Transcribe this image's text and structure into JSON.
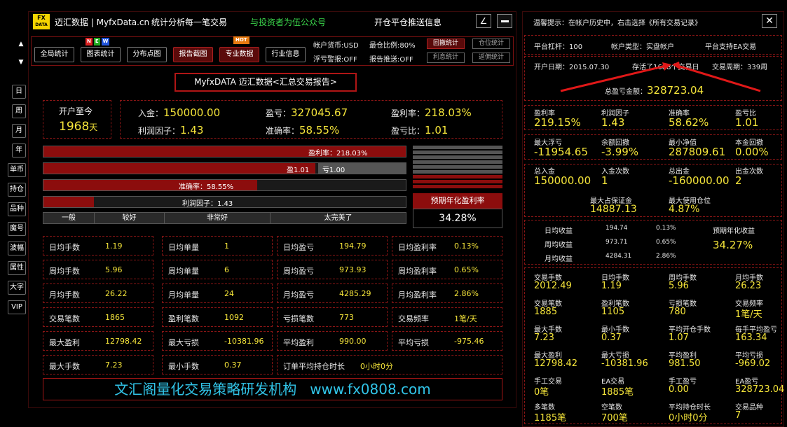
{
  "header": {
    "logo_top": "FX",
    "logo_bottom": "DATA",
    "title": "迈汇数据 | MyfxData.cn",
    "subtitle": "统计分析每一笔交易",
    "promo": "与投资者为伍公众号",
    "push": "开仓平仓推送信息"
  },
  "side": [
    "日",
    "周",
    "月",
    "年",
    "单币",
    "持仓",
    "品种",
    "魔号",
    "波幅",
    "属性",
    "大字",
    "VIP"
  ],
  "toolbar": {
    "tabs": [
      "全局统计",
      "图表统计",
      "分布点图",
      "报告截图",
      "专业数据",
      "行业信息"
    ],
    "new_badge": "NEW",
    "hot_badge": "HOT"
  },
  "account": {
    "currency": "帐户货币:USD",
    "max_ratio": "最仓比例:80%",
    "float_warn": "浮亏警报:OFF",
    "report_push": "报告推送:OFF",
    "btn1": "回撤统计",
    "btn2": "仓位统计",
    "btn3": "利息统计",
    "btn4": "返佣统计"
  },
  "report_title": "MyfxDATA 迈汇数据<汇总交易报告>",
  "summary": {
    "days_label": "开户至今",
    "days": "1968",
    "days_unit": "天",
    "deposit_k": "入金：",
    "deposit_v": "150000.00",
    "profit_k": "盈亏：",
    "profit_v": "327045.67",
    "rate_k": "盈利率：",
    "rate_v": "218.03%",
    "pf_k": "利润因子：",
    "pf_v": "1.43",
    "acc_k": "准确率：",
    "acc_v": "58.55%",
    "pl_k": "盈亏比：",
    "pl_v": "1.01"
  },
  "bars": {
    "b1": "盈利率：218.03%",
    "b2a": "盈1.01",
    "b2b": "亏1.00",
    "b3": "准确率：58.55%",
    "b4": "利润因子：1.43",
    "scale": [
      "一般",
      "较好",
      "非常好",
      "太完美了"
    ],
    "annual_label": "预期年化盈利率",
    "annual_val": "34.28%"
  },
  "bar_levels": {
    "b1": 1.0,
    "b2": 0.75,
    "b3": 0.59,
    "b4": 0.14
  },
  "grid": [
    [
      [
        "日均手数",
        "1.19"
      ],
      [
        "日均单量",
        "1"
      ],
      [
        "日均盈亏",
        "194.79"
      ],
      [
        "日均盈利率",
        "0.13%"
      ]
    ],
    [
      [
        "周均手数",
        "5.96"
      ],
      [
        "周均单量",
        "6"
      ],
      [
        "周均盈亏",
        "973.93"
      ],
      [
        "周均盈利率",
        "0.65%"
      ]
    ],
    [
      [
        "月均手数",
        "26.22"
      ],
      [
        "月均单量",
        "24"
      ],
      [
        "月均盈亏",
        "4285.29"
      ],
      [
        "月均盈利率",
        "2.86%"
      ]
    ],
    [
      [
        "交易笔数",
        "1865"
      ],
      [
        "盈利笔数",
        "1092"
      ],
      [
        "亏损笔数",
        "773"
      ],
      [
        "交易频率",
        "1笔/天"
      ]
    ],
    [
      [
        "最大盈利",
        "12798.42"
      ],
      [
        "最大亏损",
        "-10381.96"
      ],
      [
        "平均盈利",
        "990.00"
      ],
      [
        "平均亏损",
        "-975.46"
      ]
    ],
    [
      [
        "最大手数",
        "7.23"
      ],
      [
        "最小手数",
        "0.37"
      ],
      [
        "订单平均持仓时长",
        "0小时0分"
      ]
    ]
  ],
  "banner": "文汇阁量化交易策略研发机构   www.fx0808.com",
  "right": {
    "tip": "温馨提示：在帐户历史中，右击选择《所有交易记录》",
    "lev": "平台杠杆：100",
    "type": "帐户类型：实盘帐户",
    "ea": "平台支持EA交易",
    "open": "开户日期：2015.07.30",
    "alive": "存活了1688个交易日",
    "period": "交易周期：339周",
    "total_k": "总盈亏金额：",
    "total_v": "328723.04",
    "rows1": [
      [
        "盈利率",
        "219.15%"
      ],
      [
        "利润因子",
        "1.43"
      ],
      [
        "准确率",
        "58.62%"
      ],
      [
        "盈亏比",
        "1.01"
      ]
    ],
    "rows2": [
      [
        "最大浮亏",
        "-11954.65"
      ],
      [
        "余额回撤",
        "-3.99%"
      ],
      [
        "最小净值",
        "287809.61"
      ],
      [
        "本金回撤",
        "0.00%"
      ]
    ],
    "rows3": [
      [
        "总入金",
        "150000.00"
      ],
      [
        "入金次数",
        "1"
      ],
      [
        "总出金",
        "-160000.00"
      ],
      [
        "出金次数",
        "2"
      ]
    ],
    "margin_k": "最大占保证金",
    "margin_v": "14887.13",
    "pos_k": "最大使用仓位",
    "pos_v": "4.87%",
    "avg": [
      [
        "日均收益",
        "194.74",
        "0.13%"
      ],
      [
        "周均收益",
        "973.71",
        "0.65%"
      ],
      [
        "月均收益",
        "4284.31",
        "2.86%"
      ]
    ],
    "annual_k": "预期年化收益",
    "annual_v": "34.27%",
    "g1": [
      [
        "交易手数",
        "2012.49"
      ],
      [
        "日均手数",
        "1.19"
      ],
      [
        "周均手数",
        "5.96"
      ],
      [
        "月均手数",
        "26.23"
      ]
    ],
    "g2": [
      [
        "交易笔数",
        "1885"
      ],
      [
        "盈利笔数",
        "1105"
      ],
      [
        "亏损笔数",
        "780"
      ],
      [
        "交易频率",
        "1笔/天"
      ]
    ],
    "g3": [
      [
        "最大手数",
        "7.23"
      ],
      [
        "最小手数",
        "0.37"
      ],
      [
        "平均开仓手数",
        "1.07"
      ],
      [
        "每手平均盈亏",
        "163.34"
      ]
    ],
    "g4": [
      [
        "最大盈利",
        "12798.42"
      ],
      [
        "最大亏损",
        "-10381.96"
      ],
      [
        "平均盈利",
        "981.50"
      ],
      [
        "平均亏损",
        "-969.02"
      ]
    ],
    "g5": [
      [
        "手工交易",
        "0笔"
      ],
      [
        "EA交易",
        "1885笔"
      ],
      [
        "手工盈亏",
        "0.00"
      ],
      [
        "EA盈亏",
        "328723.04"
      ]
    ],
    "g6": [
      [
        "多笔数",
        "1185笔"
      ],
      [
        "空笔数",
        "700笔"
      ],
      [
        "平均持仓时长",
        "0小时0分"
      ],
      [
        "交易品种",
        "7"
      ]
    ]
  }
}
